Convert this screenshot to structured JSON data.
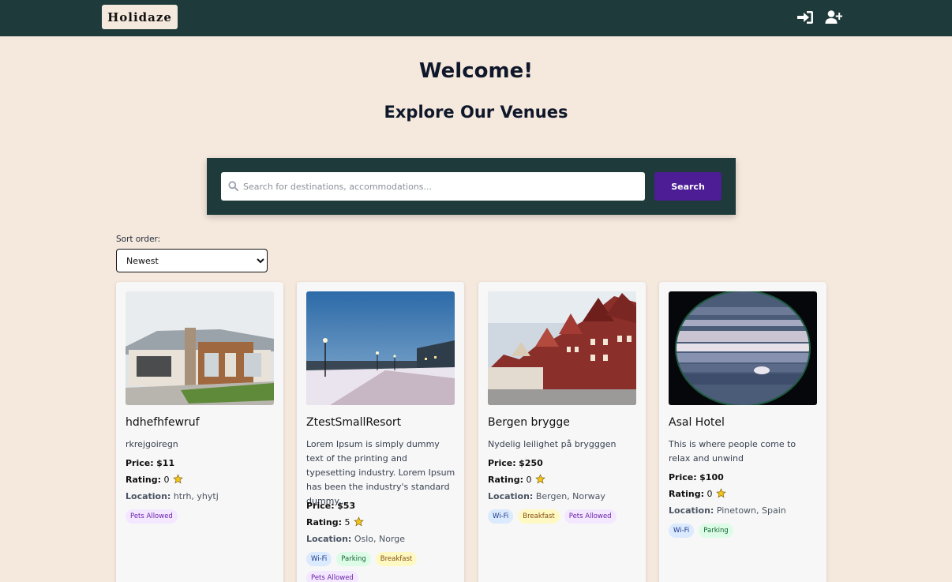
{
  "header": {
    "logo": "Holidaze",
    "login_icon": "login-icon",
    "register_icon": "user-plus-icon"
  },
  "hero": {
    "welcome": "Welcome!",
    "subtitle": "Explore Our Venues"
  },
  "search": {
    "placeholder": "Search for destinations, accommodations...",
    "value": "",
    "button_label": "Search",
    "icon": "search-icon"
  },
  "sort": {
    "label": "Sort order:",
    "selected": "Newest"
  },
  "colors": {
    "navbar": "#1f3a3a",
    "background": "#f5e8dd",
    "search_button": "#4c1d95"
  },
  "venues": [
    {
      "title": "hdhefhfewruf",
      "description": "rkrejgoiregn",
      "price_label": "Price:",
      "price": "$11",
      "rating_label": "Rating:",
      "rating": "0",
      "location_label": "Location:",
      "location": "htrh, yhytj",
      "amenities": [
        "Pets Allowed"
      ],
      "image_icon": "house-photo"
    },
    {
      "title": "ZtestSmallResort",
      "description": "Lorem Ipsum is simply dummy text of the printing and typesetting industry. Lorem Ipsum has been the industry's standard dummy...",
      "price_label": "Price:",
      "price": "$53",
      "rating_label": "Rating:",
      "rating": "5",
      "location_label": "Location:",
      "location": "Oslo, Norge",
      "amenities": [
        "Wi-Fi",
        "Parking",
        "Breakfast",
        "Pets Allowed"
      ],
      "image_icon": "winter-street-photo"
    },
    {
      "title": "Bergen brygge",
      "description": "Nydelig leilighet på brygggen",
      "price_label": "Price:",
      "price": "$250",
      "rating_label": "Rating:",
      "rating": "0",
      "location_label": "Location:",
      "location": "Bergen, Norway",
      "amenities": [
        "Wi-Fi",
        "Breakfast",
        "Pets Allowed"
      ],
      "image_icon": "bergen-houses-photo"
    },
    {
      "title": "Asal Hotel",
      "description": "This is where people come to relax and unwind",
      "price_label": "Price:",
      "price": "$100",
      "rating_label": "Rating:",
      "rating": "0",
      "location_label": "Location:",
      "location": "Pinetown, Spain",
      "amenities": [
        "Wi-Fi",
        "Parking"
      ],
      "image_icon": "planet-photo"
    }
  ]
}
